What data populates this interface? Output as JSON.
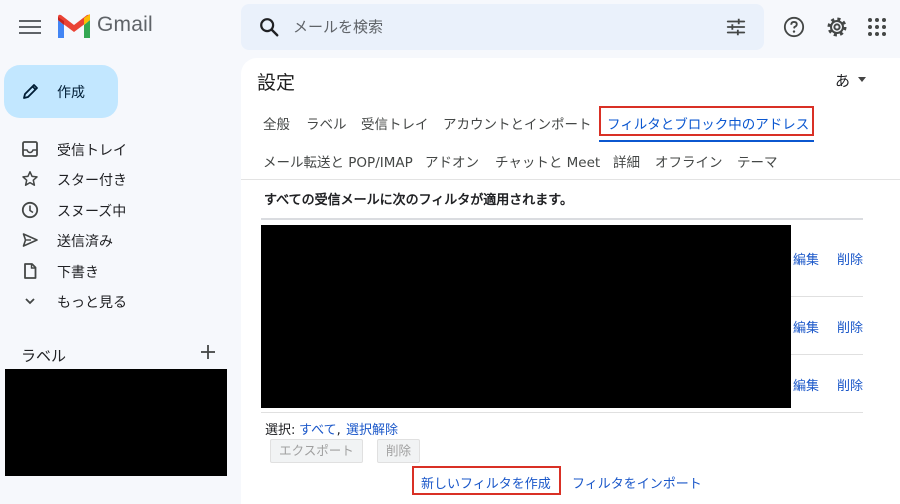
{
  "app": {
    "name": "Gmail"
  },
  "search": {
    "placeholder": "メールを検索"
  },
  "compose": {
    "label": "作成"
  },
  "nav": [
    {
      "label": "受信トレイ",
      "icon": "inbox-icon"
    },
    {
      "label": "スター付き",
      "icon": "star-icon"
    },
    {
      "label": "スヌーズ中",
      "icon": "clock-icon"
    },
    {
      "label": "送信済み",
      "icon": "send-icon"
    },
    {
      "label": "下書き",
      "icon": "draft-icon"
    },
    {
      "label": "もっと見る",
      "icon": "chevron-down-icon"
    }
  ],
  "labels": {
    "title": "ラベル"
  },
  "settings": {
    "title": "設定",
    "input_tool": "あ",
    "tabs_row1": [
      "全般",
      "ラベル",
      "受信トレイ",
      "アカウントとインポート",
      "フィルタとブロック中のアドレス"
    ],
    "tabs_row2": [
      "メール転送と POP/IMAP",
      "アドオン",
      "チャットと Meet",
      "詳細",
      "オフライン",
      "テーマ"
    ],
    "active_tab": "フィルタとブロック中のアドレス"
  },
  "filters": {
    "heading": "すべての受信メールに次のフィルタが適用されます。",
    "rows": [
      {
        "edit": "編集",
        "delete": "削除"
      },
      {
        "edit": "編集",
        "delete": "削除"
      },
      {
        "edit": "編集",
        "delete": "削除"
      }
    ],
    "select_label": "選択:",
    "select_all": "すべて",
    "select_none": "選択解除",
    "export_button": "エクスポート",
    "delete_button": "削除",
    "create_filter": "新しいフィルタを作成",
    "import_filters": "フィルタをインポート"
  },
  "colors": {
    "accent": "#0b57d0",
    "highlight_box": "#d93025",
    "compose_bg": "#c2e7ff",
    "link": "#1a57c9"
  }
}
